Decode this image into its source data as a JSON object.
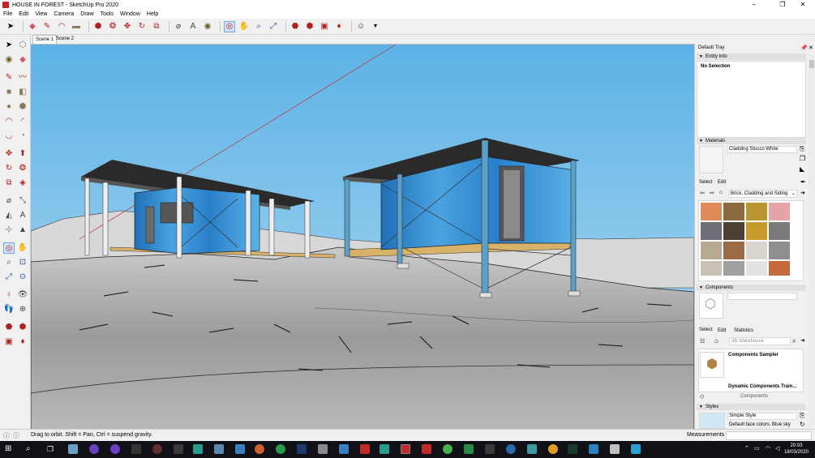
{
  "window": {
    "title": "HOUSE IN FOREST - SketchUp Pro 2020",
    "controls": [
      "–",
      "❐",
      "✕"
    ]
  },
  "menu": [
    "File",
    "Edit",
    "View",
    "Camera",
    "Draw",
    "Tools",
    "Window",
    "Help"
  ],
  "toolbar_icons": [
    "select-icon",
    "eraser-icon",
    "pencil-icon",
    "arc-icon",
    "rectangle-icon",
    "push-pull-icon",
    "follow-me-icon",
    "move-icon",
    "rotate-icon",
    "scale-icon",
    "tape-measure-icon",
    "text-icon",
    "paint-bucket-icon",
    "orbit-icon",
    "pan-icon",
    "zoom-icon",
    "zoom-extents-icon",
    "warehouse-icon",
    "extension-warehouse-icon",
    "layout-icon",
    "ruby-icon",
    "profile-icon"
  ],
  "scenes": [
    "Scene 1",
    "Scene 2"
  ],
  "tray": {
    "title": "Default Tray",
    "entity_info": {
      "header": "Entity Info",
      "value": "No Selection"
    },
    "materials": {
      "header": "Materials",
      "material_name": "Cladding Stucco White",
      "tab_select": "Select",
      "tab_edit": "Edit",
      "library": "Brick, Cladding and Siding",
      "swatch_colors": [
        "#e08a5a",
        "#8c6a3e",
        "#b9962f",
        "#e6a4a8",
        "#6d6d75",
        "#4b4033",
        "#c79a2c",
        "#7a7a7a",
        "#b8aa90",
        "#9a6b45",
        "#d9d5cf",
        "#8f8f8f",
        "#c9c1b4",
        "#a0a0a0",
        "#e2e2e2",
        "#c66a3d"
      ]
    },
    "components": {
      "header": "Components",
      "tab_select": "Select",
      "tab_edit": "Edit",
      "tab_statistics": "Statistics",
      "search_placeholder": "3D Warehouse",
      "items": [
        "Components Sampler",
        "Dynamic Components Train..."
      ],
      "footer": "Components"
    },
    "styles": {
      "header": "Styles",
      "style_name": "Simple Style",
      "description": "Default face colors. Blue sky"
    }
  },
  "status": {
    "hint": "Drag to orbit. Shift = Pan, Ctrl = suspend gravity.",
    "measurements_label": "Measurements"
  },
  "taskbar": {
    "time": "20:03",
    "date": "18/03/2020"
  }
}
